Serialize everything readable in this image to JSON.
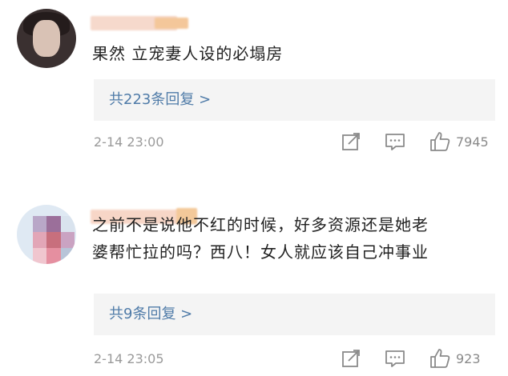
{
  "comments": [
    {
      "text_lines": [
        "果然 立宠妻人设的必塌房"
      ],
      "replies_label": "共223条回复 >",
      "time": "2-14 23:00",
      "likes": "7945"
    },
    {
      "text_lines": [
        "之前不是说他不红的时候，好多资源还是她老",
        "婆帮忙拉的吗？西八！女人就应该自己冲事业"
      ],
      "replies_label": "共9条回复 >",
      "time": "2-14 23:05",
      "likes": "923"
    }
  ],
  "icons": [
    "share-icon",
    "comment-icon",
    "like-icon"
  ],
  "colors": {
    "link": "#4f7ba8",
    "meta": "#9a9a9a",
    "reply_bg": "#f4f4f4"
  }
}
